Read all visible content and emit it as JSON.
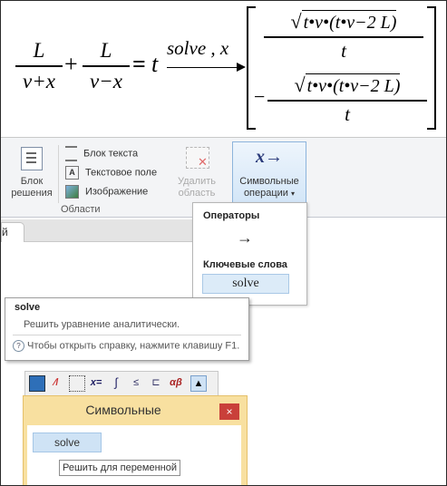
{
  "math": {
    "lhs_frac1_num": "L",
    "lhs_frac1_den": "v+x",
    "plus": "+",
    "lhs_frac2_num": "L",
    "lhs_frac2_den": "v−x",
    "equals": "=",
    "t": "t",
    "symbolic_label": "solve , x",
    "result1_num": "t•v•(t•v−2 L)",
    "result1_den": "t",
    "minus": "−",
    "result2_num": "t•v•(t•v−2 L)",
    "result2_den": "t"
  },
  "ribbon": {
    "block_label_1": "Блок",
    "block_label_2": "решения",
    "text_block": "Блок текста",
    "text_field": "Текстовое поле",
    "image": "Изображение",
    "delete_label_1": "Удалить",
    "delete_label_2": "область",
    "symbolic_icon": "x→",
    "symbolic_label_1": "Символьные",
    "symbolic_label_2": "операции",
    "group_label": "Области"
  },
  "tab": {
    "label": "й"
  },
  "dropdown": {
    "operators_heading": "Операторы",
    "arrow": "→",
    "keywords_heading": "Ключевые слова",
    "solve_chip": "solve"
  },
  "tooltip": {
    "title": "solve",
    "description": "Решить уравнение аналитически.",
    "help_icon": "?",
    "help_text": "Чтобы открыть справку, нажмите клавишу F1."
  },
  "mini_toolbar": {
    "icons": [
      "calculator-icon",
      "chart-icon",
      "matrix-icon",
      "x-equals-icon",
      "integral-icon",
      "boolean-icon",
      "program-icon",
      "greek-icon",
      "graduation-cap-icon"
    ],
    "x_equals": "x=",
    "alpha_beta": "αβ"
  },
  "palette": {
    "title": "Символьные",
    "close": "×",
    "solve_button": "solve",
    "solve_tooltip": "Решить для переменной"
  },
  "colors": {
    "palette_bg": "#f8e0a0",
    "close_red": "#c9403a",
    "chip_blue": "#dcebf8"
  }
}
